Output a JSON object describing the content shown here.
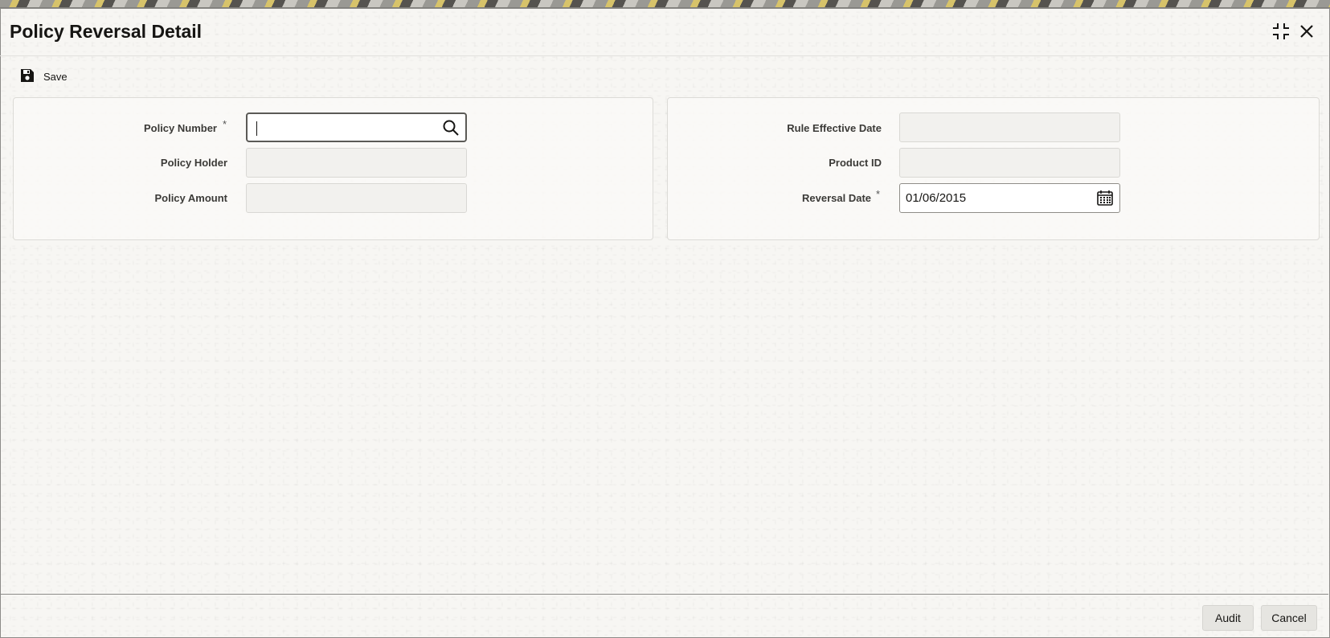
{
  "window": {
    "title": "Policy Reversal Detail"
  },
  "toolbar": {
    "save_label": "Save",
    "save_icon": "floppy-disk-icon"
  },
  "left_panel": {
    "policy_number": {
      "label": "Policy Number",
      "required_mark": "*",
      "value": "",
      "icon": "search-icon"
    },
    "policy_holder": {
      "label": "Policy Holder",
      "value": ""
    },
    "policy_amount": {
      "label": "Policy Amount",
      "value": ""
    }
  },
  "right_panel": {
    "rule_effective_date": {
      "label": "Rule Effective Date",
      "value": ""
    },
    "product_id": {
      "label": "Product ID",
      "value": ""
    },
    "reversal_date": {
      "label": "Reversal Date",
      "required_mark": "*",
      "value": "01/06/2015",
      "icon": "calendar-icon"
    }
  },
  "footer": {
    "audit_label": "Audit",
    "cancel_label": "Cancel"
  }
}
